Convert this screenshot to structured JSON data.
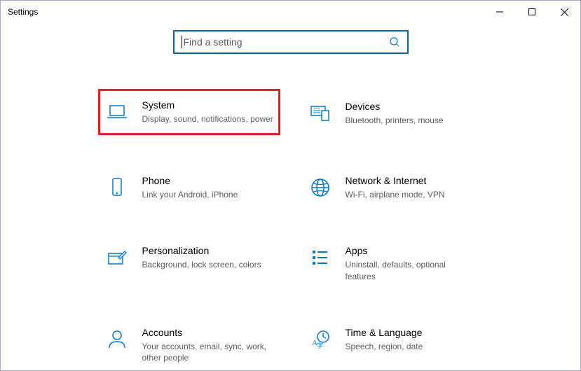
{
  "window": {
    "title": "Settings"
  },
  "search": {
    "placeholder": "Find a setting"
  },
  "tiles": [
    {
      "title": "System",
      "desc": "Display, sound, notifications, power",
      "highlight": true
    },
    {
      "title": "Devices",
      "desc": "Bluetooth, printers, mouse",
      "highlight": false
    },
    {
      "title": "Phone",
      "desc": "Link your Android, iPhone",
      "highlight": false
    },
    {
      "title": "Network & Internet",
      "desc": "Wi-Fi, airplane mode, VPN",
      "highlight": false
    },
    {
      "title": "Personalization",
      "desc": "Background, lock screen, colors",
      "highlight": false
    },
    {
      "title": "Apps",
      "desc": "Uninstall, defaults, optional features",
      "highlight": false
    },
    {
      "title": "Accounts",
      "desc": "Your accounts, email, sync, work, other people",
      "highlight": false
    },
    {
      "title": "Time & Language",
      "desc": "Speech, region, date",
      "highlight": false
    }
  ]
}
